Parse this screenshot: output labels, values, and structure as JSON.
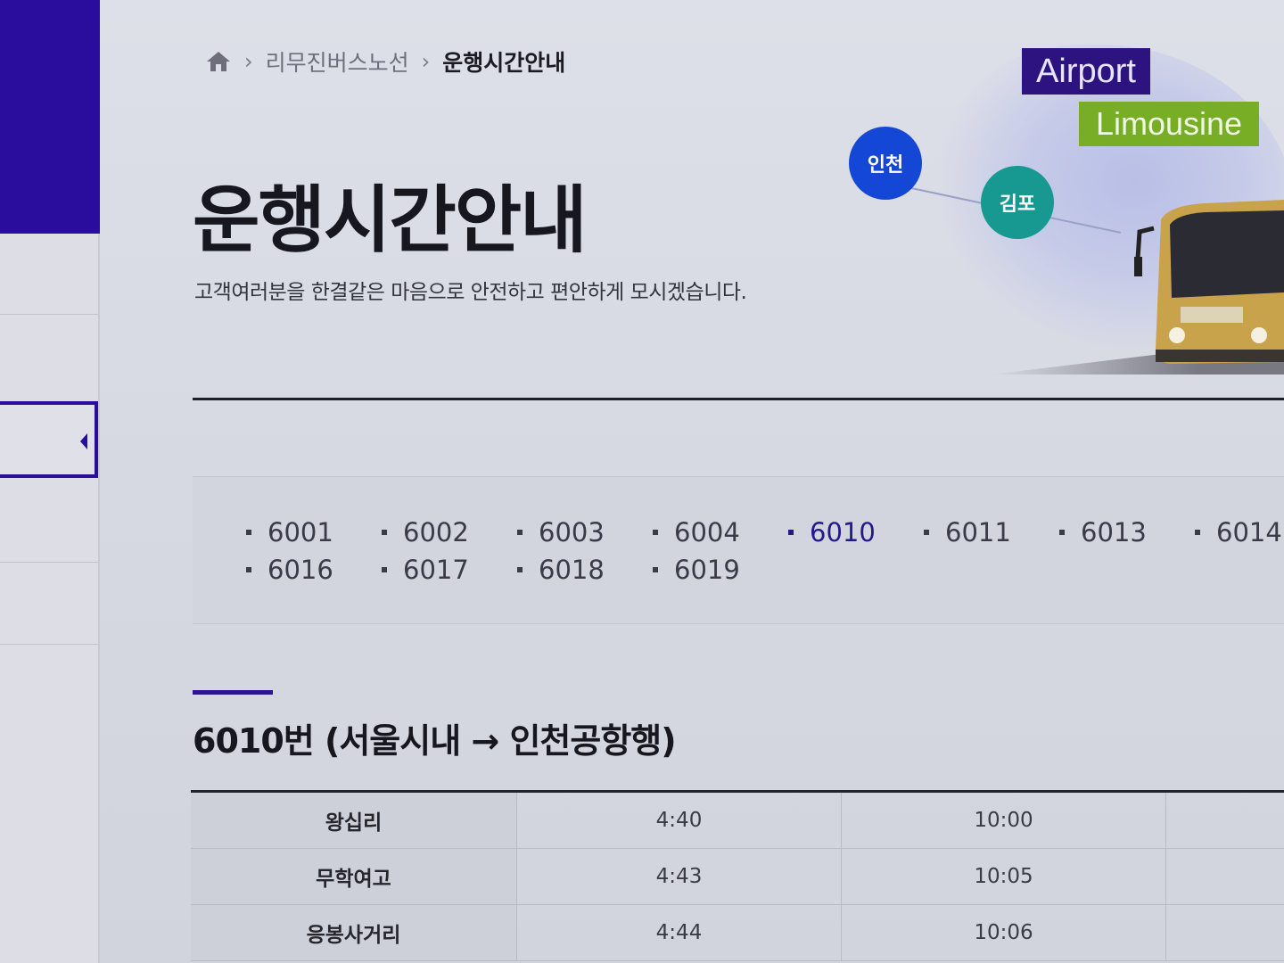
{
  "breadcrumb": {
    "items": [
      "리무진버스노선",
      "운행시간안내"
    ]
  },
  "page": {
    "title": "운행시간안내",
    "subtitle": "고객여러분을 한결같은 마음으로 안전하고 편안하게 모시겠습니다."
  },
  "banner": {
    "airport_label": "Airport",
    "limousine_label": "Limousine",
    "incheon_label": "인천",
    "gimpo_label": "김포"
  },
  "routes": {
    "active": "6010",
    "items": [
      "6001",
      "6002",
      "6003",
      "6004",
      "6010",
      "6011",
      "6013",
      "6014",
      "6016",
      "6017",
      "6018",
      "6019"
    ]
  },
  "section": {
    "title": "6010번 (서울시내 → 인천공항행)"
  },
  "timetable": {
    "rows": [
      {
        "stop": "왕십리",
        "t1": "4:40",
        "t2": "10:00"
      },
      {
        "stop": "무학여고",
        "t1": "4:43",
        "t2": "10:05"
      },
      {
        "stop": "응봉사거리",
        "t1": "4:44",
        "t2": "10:06"
      }
    ]
  },
  "colors": {
    "brand": "#2a0d9c",
    "incheon": "#1547d6",
    "gimpo": "#179891",
    "limousine": "#77ae26"
  }
}
